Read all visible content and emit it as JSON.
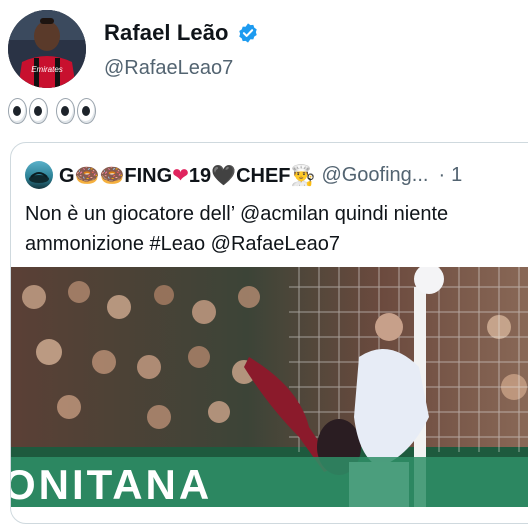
{
  "tweet": {
    "display_name": "Rafael Leão",
    "handle": "@RafaeLeao7",
    "emojis": [
      "eyes-icon",
      "eyes-icon"
    ],
    "avatar_jersey_text": "Emirates"
  },
  "quote": {
    "display_name_parts": [
      "G",
      "🍩",
      "🍩",
      "FING",
      "❤",
      "19",
      "🖤",
      "CHEF",
      "👨‍🍳"
    ],
    "handle": "@Goofing...",
    "separator": "·",
    "time": "1",
    "text": "Non è un giocatore dell’ @acmilan quindi niente ammonizione #Leao @RafaeLeao7",
    "media_banner_text": "ONITANA"
  },
  "colors": {
    "verified_blue": "#1d9bf0",
    "text_primary": "#0f1419",
    "text_secondary": "#536471",
    "border": "#cfd9de"
  }
}
